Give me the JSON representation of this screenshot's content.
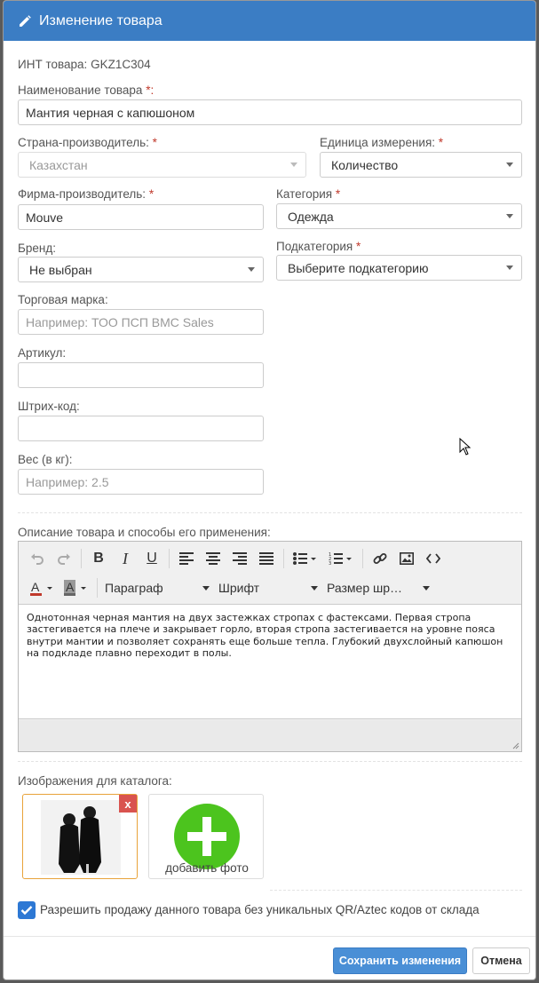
{
  "header": {
    "title": "Изменение товара",
    "icon": "pencil-icon"
  },
  "product": {
    "int_label": "ИНТ товара:",
    "int_value": "GKZ1C304"
  },
  "fields": {
    "name": {
      "label": "Наименование товара",
      "req": "*:",
      "value": "Мантия черная с капюшоном"
    },
    "country": {
      "label": "Страна-производитель:",
      "req": "*",
      "value": "Казахстан"
    },
    "unit": {
      "label": "Единица измерения:",
      "req": "*",
      "value": "Количество"
    },
    "company": {
      "label": "Фирма-производитель:",
      "req": "*",
      "value": "Mouve"
    },
    "category": {
      "label": "Категория",
      "req": "*",
      "value": "Одежда"
    },
    "brand": {
      "label": "Бренд:",
      "value": "Не выбран"
    },
    "subcategory": {
      "label": "Подкатегория",
      "req": "*",
      "placeholder": "Выберите подкатегорию"
    },
    "trademark": {
      "label": "Торговая марка:",
      "placeholder": "Например: ТОО ПСП BMC Sales"
    },
    "article": {
      "label": "Артикул:",
      "value": ""
    },
    "barcode": {
      "label": "Штрих-код:",
      "value": ""
    },
    "weight": {
      "label": "Вес (в кг):",
      "placeholder": "Например: 2.5"
    }
  },
  "description": {
    "label": "Описание товара и способы его применения:",
    "toolbar": {
      "paragraph": "Параграф",
      "font": "Шрифт",
      "size": "Размер шр…"
    },
    "text": "Однотонная черная мантия на двух застежках стропах с фастексами. Первая стропа застегивается на плече и закрывает горло, вторая стропа застегивается на уровне пояса внутри мантии и позволяет сохранять еще больше тепла. Глубокий двухслойный капюшон на подкладе плавно переходит в полы."
  },
  "images": {
    "label": "Изображения для каталога:",
    "delete_label": "x",
    "add_label": "добавить фото"
  },
  "allow_sale": {
    "checked": true,
    "label": "Разрешить продажу данного товара без уникальных QR/Aztec кодов от склада"
  },
  "footer": {
    "save_label": "Сохранить изменения",
    "cancel_label": "Отмена"
  },
  "colors": {
    "header_bg": "#3b7dc4",
    "primary": "#4a8fd6",
    "danger": "#d9534f",
    "add": "#4cc41e"
  }
}
